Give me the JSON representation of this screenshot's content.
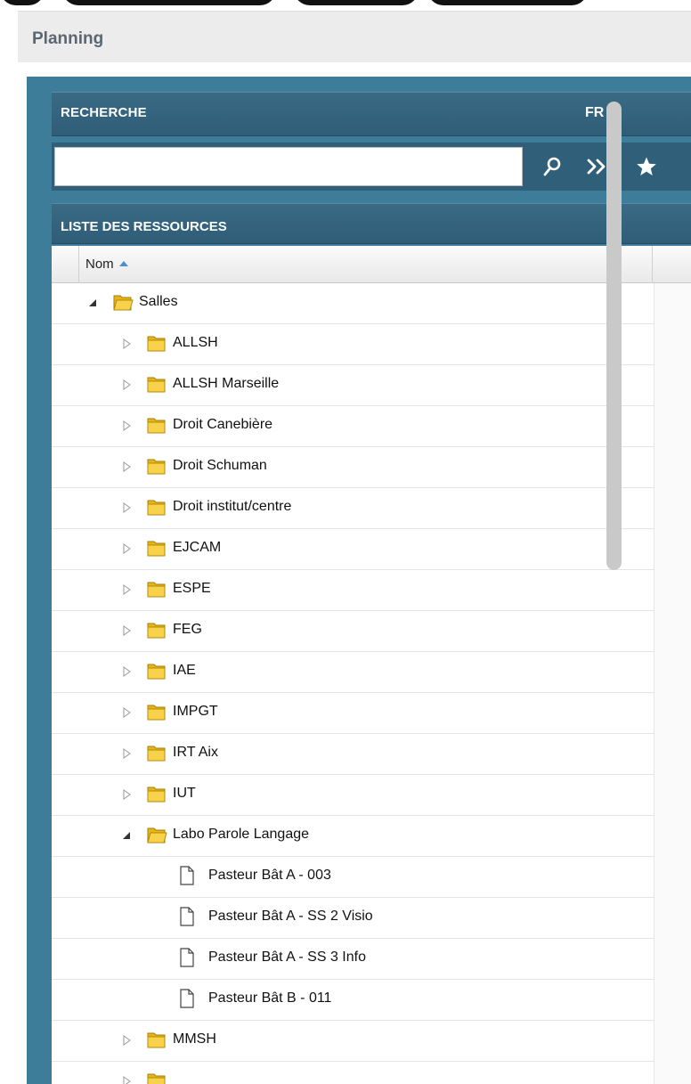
{
  "page": {
    "title": "Planning"
  },
  "search": {
    "header": "RECHERCHE",
    "language": "FR",
    "input_value": "",
    "buttons": [
      {
        "icon": "search-icon"
      },
      {
        "icon": "double-chevron-right-icon"
      },
      {
        "icon": "star-icon"
      }
    ]
  },
  "resources": {
    "header": "LISTE DES RESSOURCES",
    "column": "Nom",
    "sort": "ascending",
    "rows": [
      {
        "label": "Salles",
        "level": 0,
        "type": "folder",
        "expanded": true
      },
      {
        "label": "ALLSH",
        "level": 1,
        "type": "folder",
        "expanded": false
      },
      {
        "label": "ALLSH Marseille",
        "level": 1,
        "type": "folder",
        "expanded": false
      },
      {
        "label": "Droit Canebière",
        "level": 1,
        "type": "folder",
        "expanded": false
      },
      {
        "label": "Droit Schuman",
        "level": 1,
        "type": "folder",
        "expanded": false
      },
      {
        "label": "Droit institut/centre",
        "level": 1,
        "type": "folder",
        "expanded": false
      },
      {
        "label": "EJCAM",
        "level": 1,
        "type": "folder",
        "expanded": false
      },
      {
        "label": "ESPE",
        "level": 1,
        "type": "folder",
        "expanded": false
      },
      {
        "label": "FEG",
        "level": 1,
        "type": "folder",
        "expanded": false
      },
      {
        "label": "IAE",
        "level": 1,
        "type": "folder",
        "expanded": false
      },
      {
        "label": "IMPGT",
        "level": 1,
        "type": "folder",
        "expanded": false
      },
      {
        "label": "IRT Aix",
        "level": 1,
        "type": "folder",
        "expanded": false
      },
      {
        "label": "IUT",
        "level": 1,
        "type": "folder",
        "expanded": false
      },
      {
        "label": "Labo Parole Langage",
        "level": 1,
        "type": "folder",
        "expanded": true
      },
      {
        "label": "Pasteur Bât A - 003",
        "level": 2,
        "type": "file"
      },
      {
        "label": "Pasteur Bât A - SS 2 Visio",
        "level": 2,
        "type": "file"
      },
      {
        "label": "Pasteur Bât A - SS 3 Info",
        "level": 2,
        "type": "file"
      },
      {
        "label": "Pasteur Bât B - 011",
        "level": 2,
        "type": "file"
      },
      {
        "label": "MMSH",
        "level": 1,
        "type": "folder",
        "expanded": false
      },
      {
        "label": "",
        "level": 1,
        "type": "folder",
        "expanded": false
      }
    ]
  },
  "colors": {
    "panel": "#3e7d99",
    "header_bar": "#2f5d77",
    "folder": "#f5c518",
    "sort_arrow": "#4a8fd0"
  }
}
